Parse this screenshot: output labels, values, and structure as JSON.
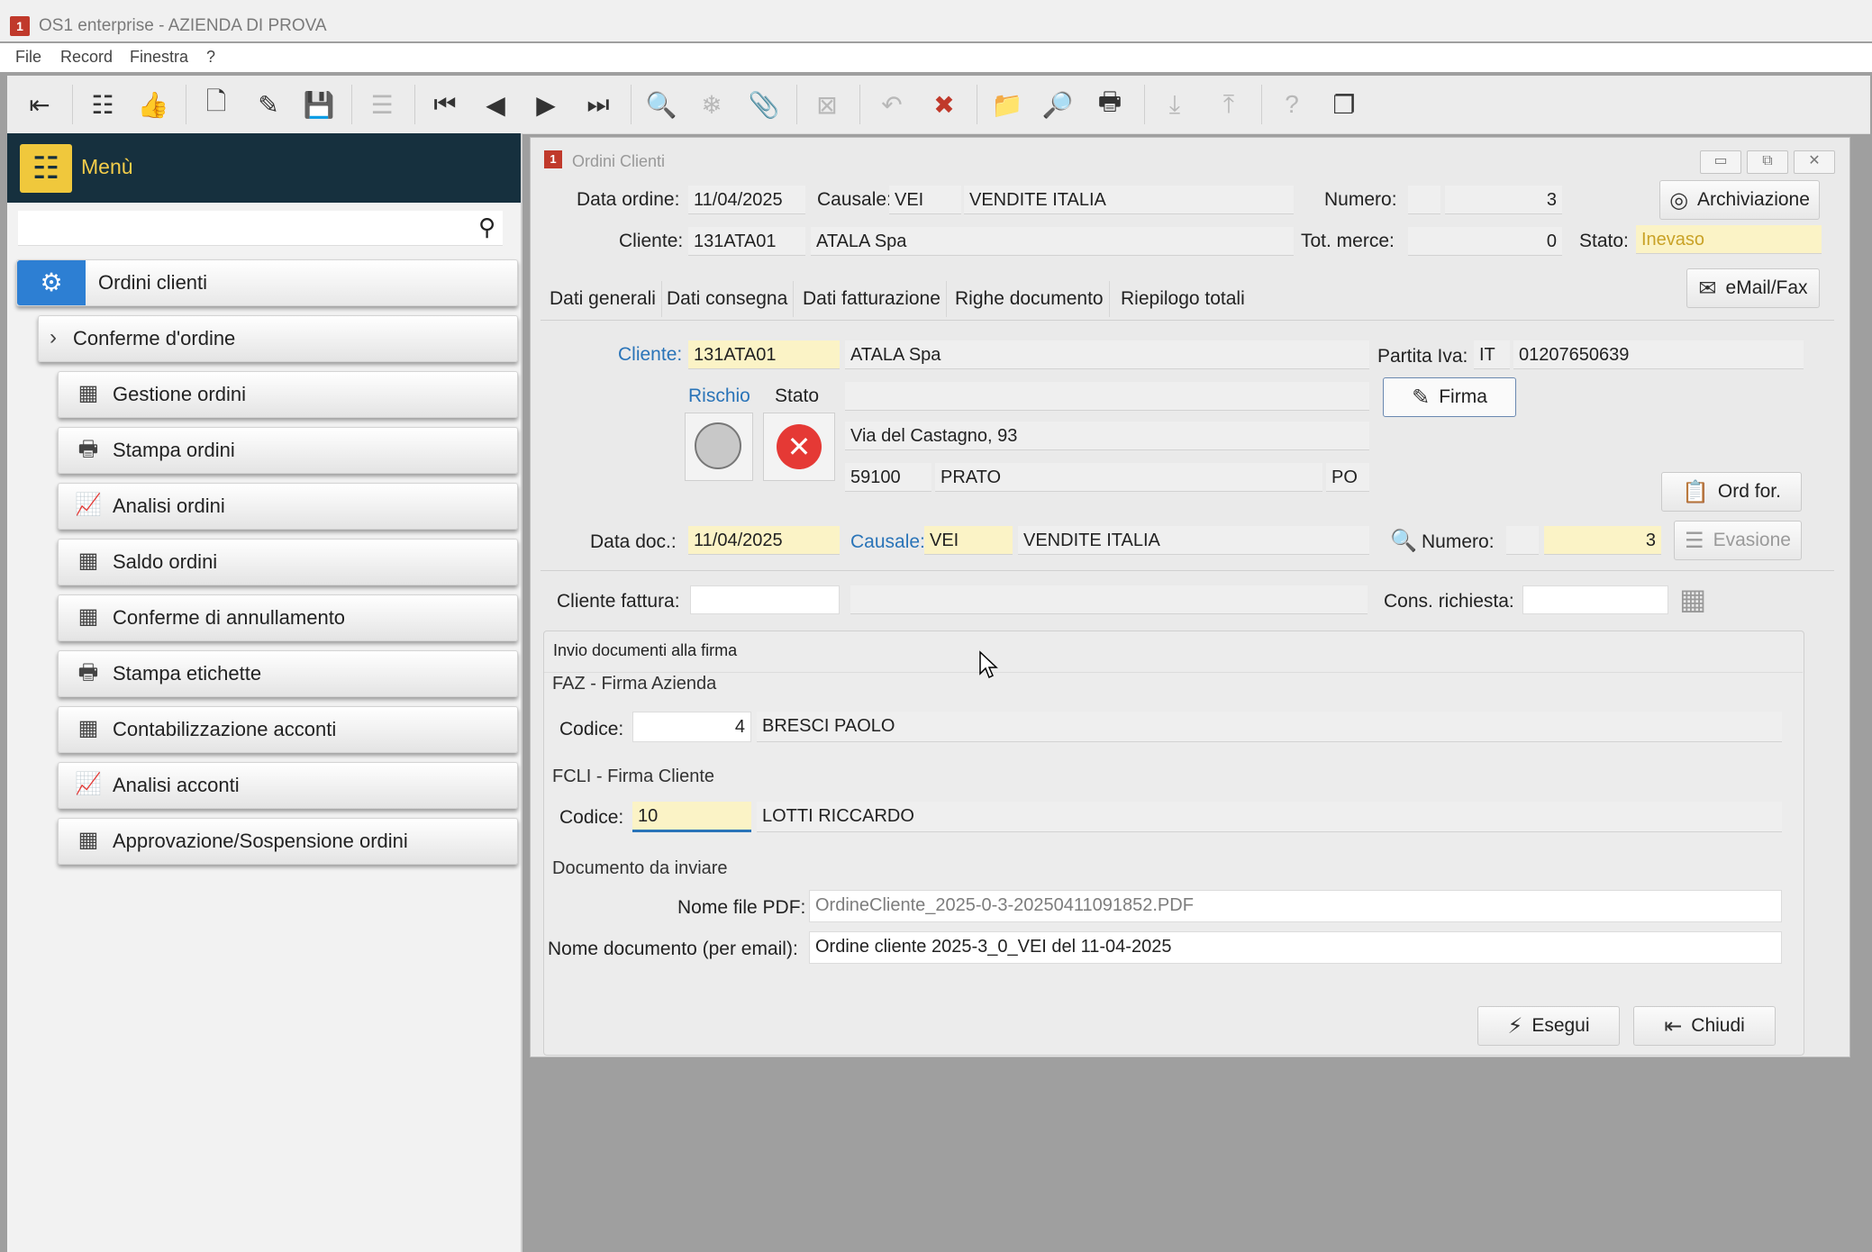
{
  "app": {
    "title": "OS1 enterprise - AZIENDA DI PROVA",
    "icon": "app-logo-icon"
  },
  "menubar": [
    "File",
    "Record",
    "Finestra",
    "?"
  ],
  "toolbar": {
    "icons": [
      "exit-icon",
      "tree-icon",
      "thumbs-up-icon",
      "new-document-icon",
      "edit-document-icon",
      "save-icon",
      "list-icon",
      "first-record-icon",
      "previous-icon",
      "next-icon",
      "last-record-icon",
      "search-icon",
      "filter-icon",
      "attachment-icon",
      "cancel-icon",
      "undo-icon",
      "delete-icon",
      "folder-icon",
      "preview-icon",
      "print-icon",
      "import-icon",
      "export-icon",
      "help-icon",
      "info-icon"
    ]
  },
  "sidebar": {
    "title": "Menù",
    "search_placeholder": "",
    "items": [
      {
        "label": "Ordini clienti",
        "icon": "gears-icon",
        "selected": true
      },
      {
        "label": "Conferme d'ordine",
        "icon": "chevron-right-icon"
      },
      {
        "label": "Gestione ordini",
        "icon": "calendar-grid-icon"
      },
      {
        "label": "Stampa ordini",
        "icon": "printer-icon"
      },
      {
        "label": "Analisi ordini",
        "icon": "chart-icon"
      },
      {
        "label": "Saldo ordini",
        "icon": "calendar-grid-icon"
      },
      {
        "label": "Conferme di annullamento",
        "icon": "calendar-grid-icon"
      },
      {
        "label": "Stampa etichette",
        "icon": "printer-icon"
      },
      {
        "label": "Contabilizzazione acconti",
        "icon": "calendar-grid-icon"
      },
      {
        "label": "Analisi acconti",
        "icon": "chart-icon"
      },
      {
        "label": "Approvazione/Sospensione ordini",
        "icon": "calendar-grid-icon"
      }
    ]
  },
  "window": {
    "title": "Ordini Clienti",
    "header": {
      "data_ordine_label": "Data ordine:",
      "data_ordine": "11/04/2025",
      "causale_label": "Causale:",
      "causale_code": "VEI",
      "causale_desc": "VENDITE ITALIA",
      "numero_label": "Numero:",
      "numero_prefix": "",
      "numero": "3",
      "archiviazione_label": "Archiviazione",
      "cliente_label": "Cliente:",
      "cliente_code": "131ATA01",
      "cliente_name": "ATALA Spa",
      "tot_merce_label": "Tot. merce:",
      "tot_merce": "0",
      "stato_label": "Stato:",
      "stato": "Inevaso"
    },
    "tabs": [
      "Dati generali",
      "Dati consegna",
      "Dati fatturazione",
      "Righe documento",
      "Riepilogo totali"
    ],
    "email_fax_label": "eMail/Fax",
    "general": {
      "cliente_label": "Cliente:",
      "cliente_code": "131ATA01",
      "cliente_name": "ATALA Spa",
      "partita_iva_label": "Partita Iva:",
      "partita_iva_country": "IT",
      "partita_iva": "01207650639",
      "rischio_label": "Rischio",
      "stato_label": "Stato",
      "address_extra": "",
      "address": "Via del Castagno, 93",
      "cap": "59100",
      "city": "PRATO",
      "province": "PO",
      "firma_label": "Firma",
      "ord_for_label": "Ord for.",
      "data_doc_label": "Data doc.:",
      "data_doc": "11/04/2025",
      "causale_label": "Causale:",
      "causale_code": "VEI",
      "causale_desc": "VENDITE ITALIA",
      "numero_label": "Numero:",
      "numero": "3",
      "evasione_label": "Evasione",
      "cliente_fattura_label": "Cliente fattura:",
      "cons_richiesta_label": "Cons. richiesta:"
    },
    "popup": {
      "title": "Invio documenti alla firma",
      "faz_title": "FAZ - Firma Azienda",
      "faz_codice_label": "Codice:",
      "faz_codice": "4",
      "faz_name": "BRESCI PAOLO",
      "fcli_title": "FCLI - Firma Cliente",
      "fcli_codice_label": "Codice:",
      "fcli_codice": "10",
      "fcli_name": "LOTTI RICCARDO",
      "doc_title": "Documento da inviare",
      "pdf_label": "Nome file PDF:",
      "pdf_value": "OrdineCliente_2025-0-3-20250411091852.PDF",
      "docname_label": "Nome documento (per email):",
      "docname_value": "Ordine cliente 2025-3_0_VEI del 11-04-2025",
      "esegui_label": "Esegui",
      "chiudi_label": "Chiudi"
    }
  },
  "colors": {
    "sidebar_header": "#16303e",
    "accent_yellow": "#f4cd4a",
    "highlight_field": "#fbf3c6",
    "link_blue": "#2a74b8",
    "error_red": "#e53935"
  }
}
